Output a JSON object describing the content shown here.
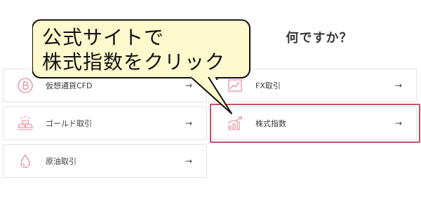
{
  "heading": {
    "visible_text": "何ですか？"
  },
  "options": {
    "crypto": {
      "label": "仮想通貨CFD",
      "icon": "bitcoin-icon",
      "arrow": "→"
    },
    "fx": {
      "label": "FX取引",
      "icon": "chart-line-icon",
      "arrow": "→"
    },
    "gold": {
      "label": "ゴールド取引",
      "icon": "gold-bars-icon",
      "arrow": "→"
    },
    "stock_index": {
      "label": "株式指数",
      "icon": "bar-chart-trend-icon",
      "arrow": "→"
    },
    "oil": {
      "label": "原油取引",
      "icon": "oil-drop-icon",
      "arrow": "→"
    }
  },
  "callout": {
    "line1": "公式サイトで",
    "line2": "株式指数をクリック"
  },
  "colors": {
    "accent_pink": "#c1506a",
    "icon_pink": "#e08a94",
    "callout_fill": "#fffacd",
    "card_border": "#e3e3e3"
  }
}
